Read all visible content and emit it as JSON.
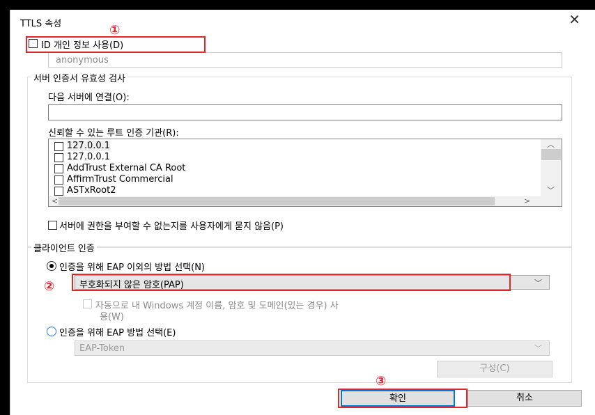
{
  "window": {
    "title": "TTLS 속성",
    "close_glyph": "✕"
  },
  "identity": {
    "checkbox_label": "ID 개인 정보 사용(D)",
    "value": "anonymous"
  },
  "server_cert": {
    "group_title": "서버 인증서 유효성 검사",
    "connect_label": "다음 서버에 연결(O):",
    "connect_value": "",
    "root_ca_label": "신뢰할 수 있는 루트 인증 기관(R):",
    "root_cas": [
      "127.0.0.1",
      "127.0.0.1",
      "AddTrust External CA Root",
      "AffirmTrust Commercial",
      "ASTxRoot2"
    ],
    "no_prompt_label": "서버에 권한을 부여할 수 없는지를 사용자에게 묻지 않음(P)"
  },
  "client_auth": {
    "group_title": "클라이언트 인증",
    "non_eap_label": "인증을 위해 EAP 이외의 방법 선택(N)",
    "non_eap_selected": true,
    "non_eap_method": "부호화되지 않은 암호(PAP)",
    "auto_windows_label_line1": "자동으로 내 Windows 계정 이름, 암호 및 도메인(있는 경우) 사",
    "auto_windows_label_line2": "용(W)",
    "eap_label": "인증을 위해 EAP 방법 선택(E)",
    "eap_selected": false,
    "eap_method": "EAP-Token",
    "configure_label": "구성(C)"
  },
  "buttons": {
    "ok": "확인",
    "cancel": "취소"
  },
  "annotations": {
    "one": "①",
    "two": "②",
    "three": "③",
    "color": "#e3262a"
  },
  "scroll_glyphs": {
    "up": "︿",
    "down": "﹀",
    "left": "<",
    "right": ">",
    "chevron": "﹀"
  }
}
